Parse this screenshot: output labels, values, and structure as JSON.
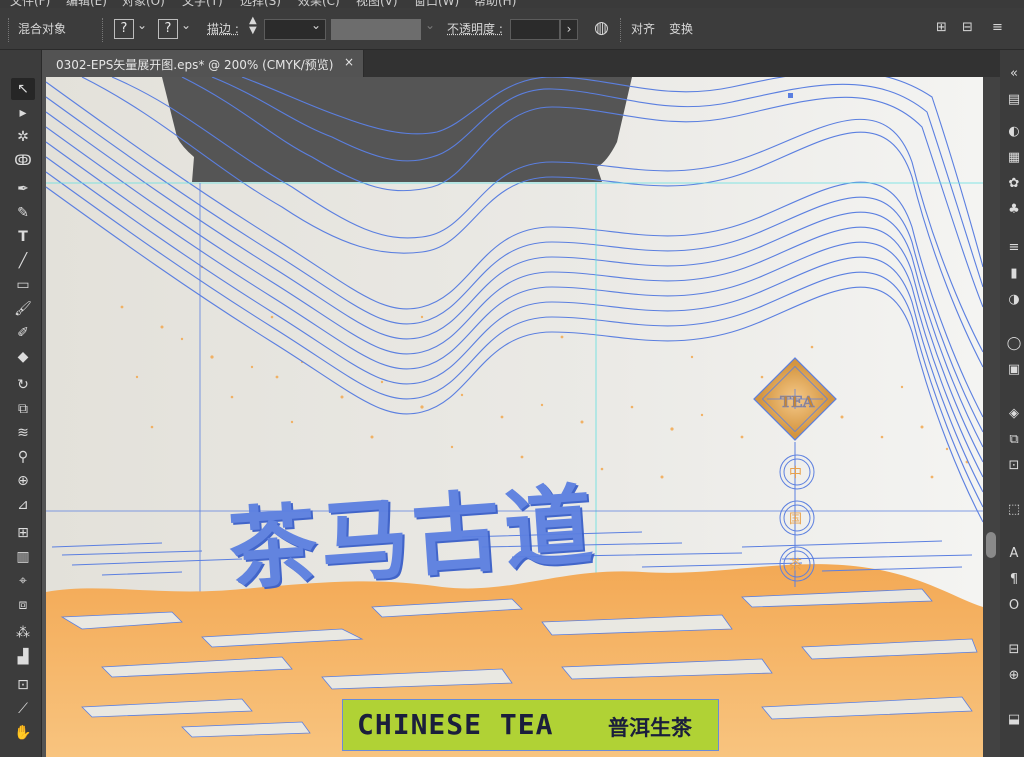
{
  "menu": [
    "文件(F)",
    "编辑(E)",
    "对象(O)",
    "文字(T)",
    "选择(S)",
    "效果(C)",
    "视图(V)",
    "窗口(W)",
    "帮助(H)"
  ],
  "controlbar": {
    "object_type": "混合对象",
    "fill_symbol": "?",
    "stroke_symbol": "?",
    "stroke_label": "描边 :",
    "opacity_label": "不透明度 :",
    "align_label": "对齐",
    "transform_label": "变换"
  },
  "document_tab": {
    "title": "0302-EPS矢量展开图.eps* @ 200% (CMYK/预览)",
    "close": "×"
  },
  "artwork": {
    "calligraphy": "茶马古道",
    "banner_en": "CHINESE TEA",
    "banner_cn": "普洱生茶",
    "diamond_text": "TEA",
    "medallion_chars": [
      "中",
      "国",
      "茶"
    ]
  },
  "colors": {
    "ui_bg": "#535353",
    "panel_bg": "#3c3c3c",
    "selection_blue": "#5b7fe0",
    "guide_cyan": "#5fe0e0",
    "orange": "#f5b15c",
    "banner_green": "#b0d235",
    "dark_box": "#555555"
  },
  "tools_left": [
    "selection-icon",
    "direct-selection-icon",
    "magic-wand-icon",
    "lasso-icon",
    "pen-icon",
    "curvature-icon",
    "type-icon",
    "line-icon",
    "rectangle-icon",
    "paintbrush-icon",
    "blob-brush-icon",
    "eraser-icon",
    "rotate-icon",
    "scale-icon",
    "warp-icon",
    "puppet-warp-icon",
    "shape-builder-icon",
    "perspective-icon",
    "mesh-icon",
    "gradient-icon",
    "eyedropper-icon",
    "blend-icon",
    "symbol-sprayer-icon",
    "graph-icon",
    "artboard-icon",
    "slice-icon",
    "hand-icon"
  ]
}
